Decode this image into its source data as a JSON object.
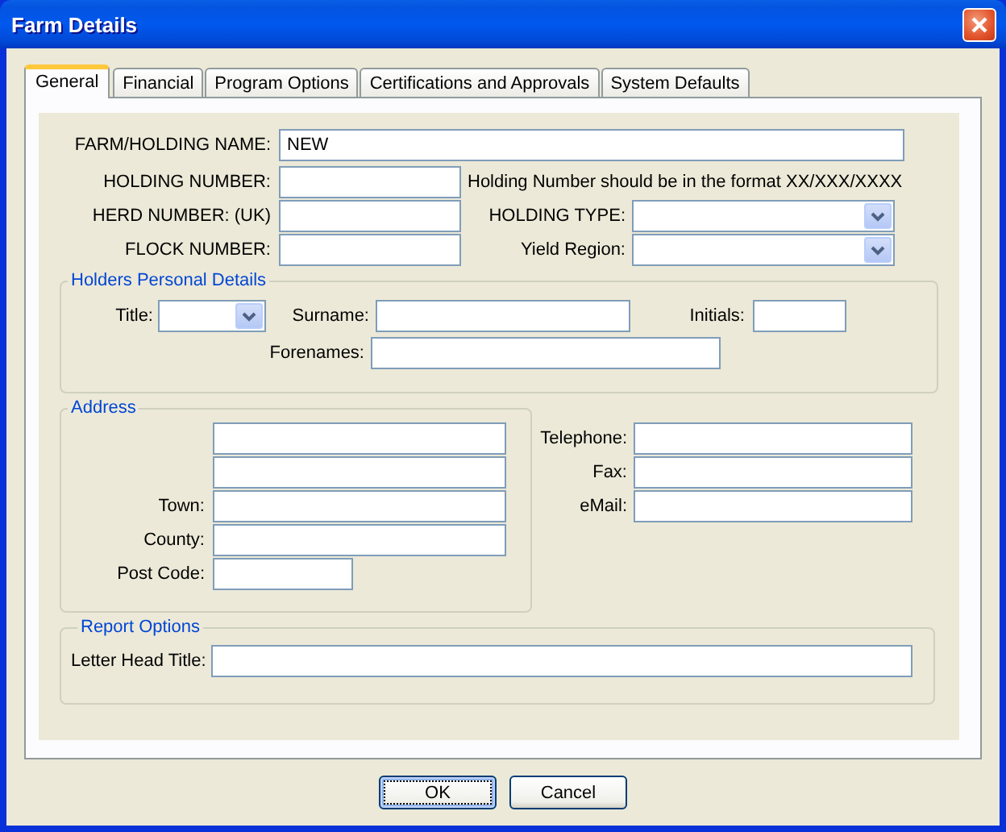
{
  "window": {
    "title": "Farm Details"
  },
  "tabs": [
    {
      "label": "General",
      "selected": true
    },
    {
      "label": "Financial",
      "selected": false
    },
    {
      "label": "Program Options",
      "selected": false
    },
    {
      "label": "Certifications and Approvals",
      "selected": false
    },
    {
      "label": "System Defaults",
      "selected": false
    }
  ],
  "holding": {
    "name": {
      "label": "FARM/HOLDING NAME:",
      "value": "NEW"
    },
    "number": {
      "label": "HOLDING NUMBER:",
      "note": "Holding Number should be in the format XX/XXX/XXXX"
    },
    "herd_number": {
      "label": "HERD NUMBER: (UK)"
    },
    "holding_type": {
      "label": "HOLDING TYPE:"
    },
    "flock_number": {
      "label": "FLOCK NUMBER:"
    },
    "yield_region": {
      "label": "Yield Region:"
    }
  },
  "personal_details": {
    "title": "Holders Personal Details",
    "title_field": {
      "label": "Title:"
    },
    "surname": {
      "label": "Surname:"
    },
    "initials": {
      "label": "Initials:"
    },
    "forenames": {
      "label": "Forenames:"
    }
  },
  "address": {
    "title": "Address",
    "lines": [
      {
        "kind": "line"
      },
      {
        "kind": "line"
      },
      {
        "kind": "line",
        "label": "Town:"
      },
      {
        "kind": "line",
        "label": "County:"
      },
      {
        "kind": "short",
        "label": "Post Code:"
      }
    ]
  },
  "contacts": [
    {
      "label": "Telephone:"
    },
    {
      "label": "Fax:"
    },
    {
      "label": "eMail:"
    }
  ],
  "report_options": {
    "title": "Report Options",
    "letter_head": {
      "label": "Letter Head Title:"
    }
  },
  "buttons": [
    {
      "label": "OK",
      "default": true
    },
    {
      "label": "Cancel",
      "default": false
    }
  ]
}
